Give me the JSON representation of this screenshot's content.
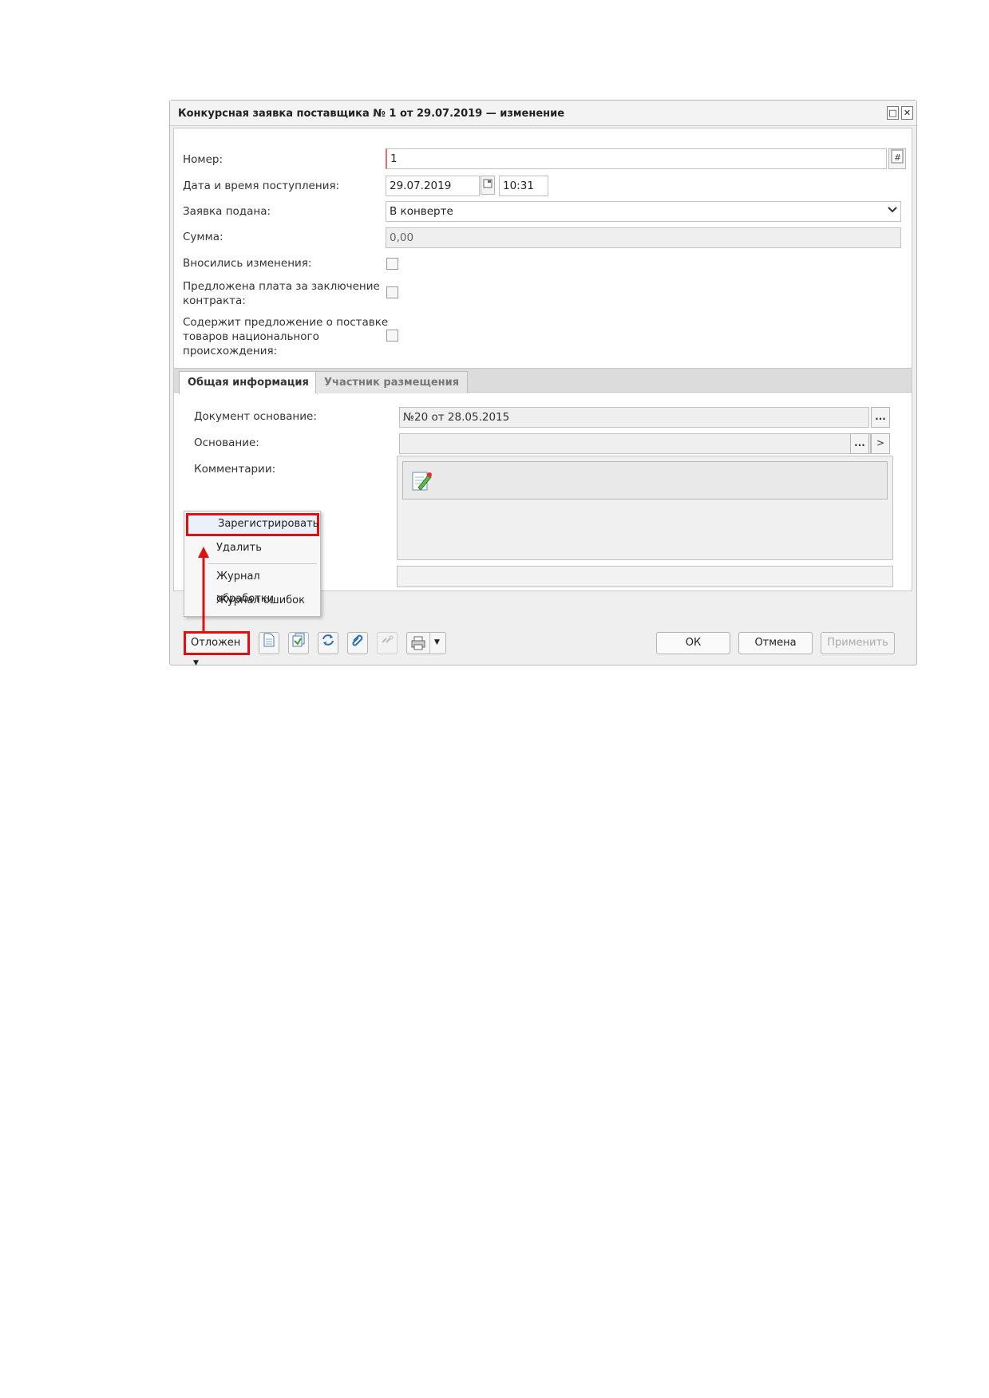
{
  "dialog": {
    "title": "Конкурсная заявка поставщика № 1 от 29.07.2019 — изменение",
    "window_buttons": [
      "□",
      "✕"
    ]
  },
  "form": {
    "number_label": "Номер:",
    "number_value": "1",
    "date_label": "Дата и время поступления:",
    "date_value": "29.07.2019",
    "time_value": "10:31",
    "submitted_label": "Заявка подана:",
    "submitted_value": "В конверте",
    "sum_label": "Сумма:",
    "sum_value": "0,00",
    "changes_label": "Вносились изменения:",
    "fee_label_1": "Предложена плата за заключение",
    "fee_label_2": "контракта:",
    "national_label_1": "Содержит предложение о поставке",
    "national_label_2": "товаров национального",
    "national_label_3": "происхождения:"
  },
  "tabs": {
    "general": "Общая информация",
    "participant": "Участник размещения"
  },
  "general": {
    "doc_basis_label": "Документ основание:",
    "doc_basis_value": "№20 от 28.05.2015",
    "basis_label": "Основание:",
    "basis_value": "",
    "comments_label": "Комментарии:",
    "ellipsis": "...",
    "forward": ">"
  },
  "menu": {
    "register": "Зарегистрировать",
    "delete": "Удалить",
    "processing_log": "Журнал обработки",
    "error_log": "Журнал ошибок"
  },
  "footer": {
    "status_label": "Отложен",
    "ok": "ОК",
    "cancel": "Отмена",
    "apply": "Применить"
  },
  "colors": {
    "highlight": "#e01010",
    "required_border": "#e86b6b"
  }
}
